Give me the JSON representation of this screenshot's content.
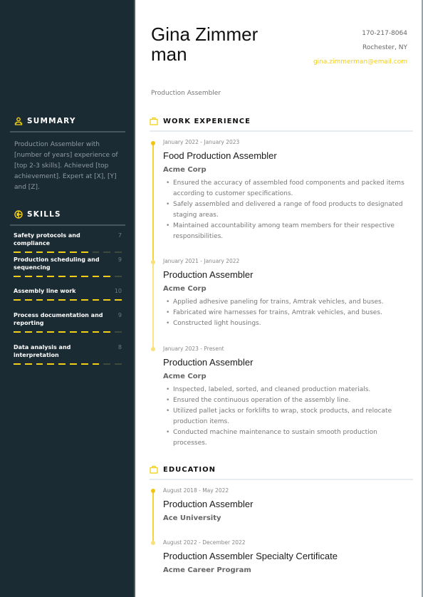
{
  "header": {
    "name": "Gina Zimmerman",
    "title": "Production Assembler",
    "contact": {
      "phone": "170-217-8064",
      "location": "Rochester, NY",
      "email": "gina.zimmerman@email.com"
    }
  },
  "sidebar": {
    "summary": {
      "heading": "SUMMARY",
      "icon": "person-icon",
      "text": "Production Assembler with [number of years] experience of [top 2-3 skills]. Achieved [top achievement]. Expert at [X], [Y] and [Z]."
    },
    "skills": {
      "heading": "SKILLS",
      "icon": "compass-icon",
      "scale_max": 10,
      "items": [
        {
          "name": "Safety protocols and compliance",
          "level": "7",
          "value": 7
        },
        {
          "name": "Production scheduling and sequencing",
          "level": "9",
          "value": 9
        },
        {
          "name": "Assembly line work",
          "level": "10",
          "value": 10
        },
        {
          "name": "Process documentation and reporting",
          "level": "9",
          "value": 9
        },
        {
          "name": "Data analysis and interpretation",
          "level": "8",
          "value": 8
        }
      ]
    }
  },
  "work_experience": {
    "heading": "WORK EXPERIENCE",
    "icon": "briefcase-icon",
    "entries": [
      {
        "date": "January 2022 - January 2023",
        "role": "Food Production Assembler",
        "org": "Acme Corp",
        "bullets": [
          "Ensured the accuracy of assembled food components and packed items according to customer specifications.",
          "Safely assembled and delivered a range of food products to designated staging areas.",
          "Maintained accountability among team members for their respective responsibilities."
        ]
      },
      {
        "date": "January 2021 - January 2022",
        "role": "Production Assembler",
        "org": "Acme Corp",
        "bullets": [
          "Applied adhesive paneling for trains, Amtrak vehicles, and buses.",
          "Fabricated wire harnesses for trains, Amtrak vehicles, and buses.",
          "Constructed light housings."
        ]
      },
      {
        "date": "January 2023 - Present",
        "role": "Production Assembler",
        "org": "Acme Corp",
        "bullets": [
          "Inspected, labeled, sorted, and cleaned production materials.",
          "Ensured the continuous operation of the assembly line.",
          "Utilized pallet jacks or forklifts to wrap, stock products, and relocate production items.",
          "Conducted machine maintenance to sustain smooth production processes."
        ]
      }
    ]
  },
  "education": {
    "heading": "EDUCATION",
    "icon": "briefcase-icon",
    "entries": [
      {
        "date": "August 2018 - May 2022",
        "role": "Production Assembler",
        "org": "Ace University"
      },
      {
        "date": "August 2022 - December 2022",
        "role": "Production Assembler Specialty Certificate",
        "org": "Acme Career Program"
      }
    ]
  },
  "colors": {
    "accent": "#f2cf13",
    "sidebar_bg": "#1b2b33"
  }
}
